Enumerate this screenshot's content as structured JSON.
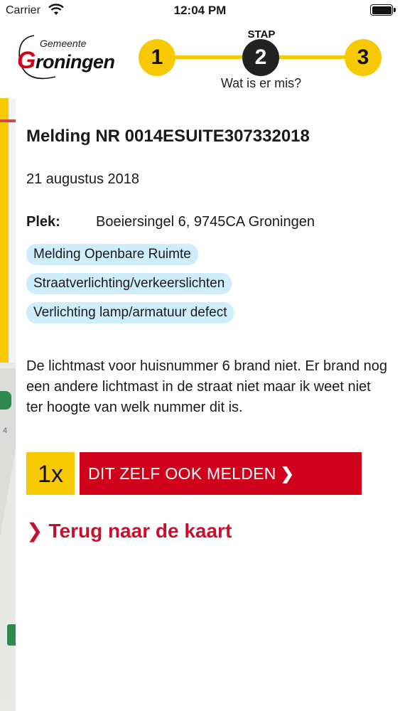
{
  "status_bar": {
    "carrier": "Carrier",
    "time": "12:04 PM"
  },
  "header": {
    "logo_top": "Gemeente",
    "logo_main_initial": "G",
    "logo_main_rest": "roningen",
    "stepper": {
      "label": "STAP",
      "steps": [
        "1",
        "2",
        "3"
      ],
      "current": 2,
      "caption": "Wat is er mis?"
    }
  },
  "report": {
    "title": "Melding NR 0014ESUITE307332018",
    "date": "21 augustus 2018",
    "location_label": "Plek:",
    "location_value": "Boeiersingel 6, 9745CA Groningen",
    "tags": [
      "Melding Openbare Ruimte",
      "Straatverlichting/verkeerslichten",
      "Verlichting lamp/armatuur defect"
    ],
    "description": "De lichtmast voor huisnummer 6 brand niet. Er brand nog een andere lichtmast in de straat niet maar ik weet niet ter hoogte van welk nummer dit is."
  },
  "actions": {
    "count": "1x",
    "report_label": "DIT ZELF OOK MELDEN",
    "back_label": "Terug naar de kaart"
  },
  "map": {
    "label": "4"
  },
  "colors": {
    "accent_yellow": "#f6c900",
    "accent_red": "#d0021b",
    "tag_bg": "#cfeefb"
  }
}
